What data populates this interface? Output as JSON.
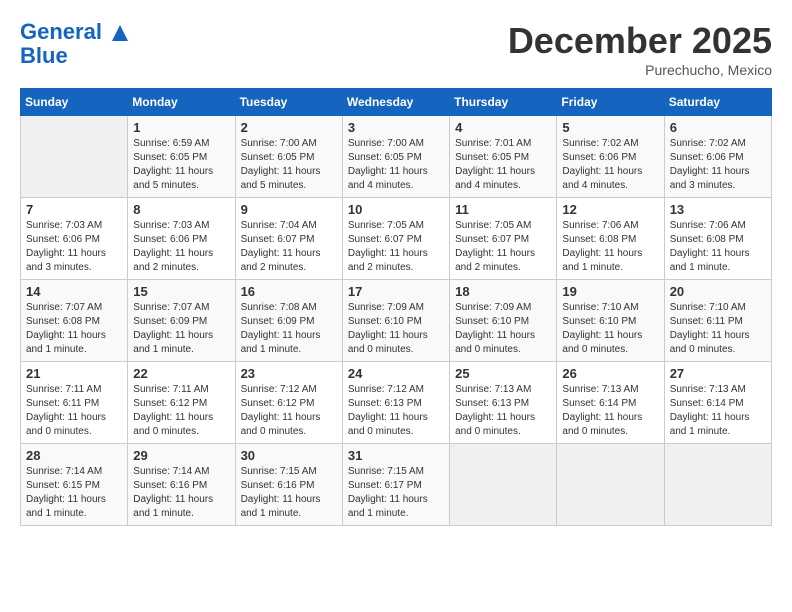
{
  "header": {
    "logo_line1": "General",
    "logo_line2": "Blue",
    "month": "December 2025",
    "location": "Purechucho, Mexico"
  },
  "days_of_week": [
    "Sunday",
    "Monday",
    "Tuesday",
    "Wednesday",
    "Thursday",
    "Friday",
    "Saturday"
  ],
  "weeks": [
    [
      {
        "num": "",
        "empty": true
      },
      {
        "num": "1",
        "sunrise": "6:59 AM",
        "sunset": "6:05 PM",
        "daylight": "11 hours and 5 minutes."
      },
      {
        "num": "2",
        "sunrise": "7:00 AM",
        "sunset": "6:05 PM",
        "daylight": "11 hours and 5 minutes."
      },
      {
        "num": "3",
        "sunrise": "7:00 AM",
        "sunset": "6:05 PM",
        "daylight": "11 hours and 4 minutes."
      },
      {
        "num": "4",
        "sunrise": "7:01 AM",
        "sunset": "6:05 PM",
        "daylight": "11 hours and 4 minutes."
      },
      {
        "num": "5",
        "sunrise": "7:02 AM",
        "sunset": "6:06 PM",
        "daylight": "11 hours and 4 minutes."
      },
      {
        "num": "6",
        "sunrise": "7:02 AM",
        "sunset": "6:06 PM",
        "daylight": "11 hours and 3 minutes."
      }
    ],
    [
      {
        "num": "7",
        "sunrise": "7:03 AM",
        "sunset": "6:06 PM",
        "daylight": "11 hours and 3 minutes."
      },
      {
        "num": "8",
        "sunrise": "7:03 AM",
        "sunset": "6:06 PM",
        "daylight": "11 hours and 2 minutes."
      },
      {
        "num": "9",
        "sunrise": "7:04 AM",
        "sunset": "6:07 PM",
        "daylight": "11 hours and 2 minutes."
      },
      {
        "num": "10",
        "sunrise": "7:05 AM",
        "sunset": "6:07 PM",
        "daylight": "11 hours and 2 minutes."
      },
      {
        "num": "11",
        "sunrise": "7:05 AM",
        "sunset": "6:07 PM",
        "daylight": "11 hours and 2 minutes."
      },
      {
        "num": "12",
        "sunrise": "7:06 AM",
        "sunset": "6:08 PM",
        "daylight": "11 hours and 1 minute."
      },
      {
        "num": "13",
        "sunrise": "7:06 AM",
        "sunset": "6:08 PM",
        "daylight": "11 hours and 1 minute."
      }
    ],
    [
      {
        "num": "14",
        "sunrise": "7:07 AM",
        "sunset": "6:08 PM",
        "daylight": "11 hours and 1 minute."
      },
      {
        "num": "15",
        "sunrise": "7:07 AM",
        "sunset": "6:09 PM",
        "daylight": "11 hours and 1 minute."
      },
      {
        "num": "16",
        "sunrise": "7:08 AM",
        "sunset": "6:09 PM",
        "daylight": "11 hours and 1 minute."
      },
      {
        "num": "17",
        "sunrise": "7:09 AM",
        "sunset": "6:10 PM",
        "daylight": "11 hours and 0 minutes."
      },
      {
        "num": "18",
        "sunrise": "7:09 AM",
        "sunset": "6:10 PM",
        "daylight": "11 hours and 0 minutes."
      },
      {
        "num": "19",
        "sunrise": "7:10 AM",
        "sunset": "6:10 PM",
        "daylight": "11 hours and 0 minutes."
      },
      {
        "num": "20",
        "sunrise": "7:10 AM",
        "sunset": "6:11 PM",
        "daylight": "11 hours and 0 minutes."
      }
    ],
    [
      {
        "num": "21",
        "sunrise": "7:11 AM",
        "sunset": "6:11 PM",
        "daylight": "11 hours and 0 minutes."
      },
      {
        "num": "22",
        "sunrise": "7:11 AM",
        "sunset": "6:12 PM",
        "daylight": "11 hours and 0 minutes."
      },
      {
        "num": "23",
        "sunrise": "7:12 AM",
        "sunset": "6:12 PM",
        "daylight": "11 hours and 0 minutes."
      },
      {
        "num": "24",
        "sunrise": "7:12 AM",
        "sunset": "6:13 PM",
        "daylight": "11 hours and 0 minutes."
      },
      {
        "num": "25",
        "sunrise": "7:13 AM",
        "sunset": "6:13 PM",
        "daylight": "11 hours and 0 minutes."
      },
      {
        "num": "26",
        "sunrise": "7:13 AM",
        "sunset": "6:14 PM",
        "daylight": "11 hours and 0 minutes."
      },
      {
        "num": "27",
        "sunrise": "7:13 AM",
        "sunset": "6:14 PM",
        "daylight": "11 hours and 1 minute."
      }
    ],
    [
      {
        "num": "28",
        "sunrise": "7:14 AM",
        "sunset": "6:15 PM",
        "daylight": "11 hours and 1 minute."
      },
      {
        "num": "29",
        "sunrise": "7:14 AM",
        "sunset": "6:16 PM",
        "daylight": "11 hours and 1 minute."
      },
      {
        "num": "30",
        "sunrise": "7:15 AM",
        "sunset": "6:16 PM",
        "daylight": "11 hours and 1 minute."
      },
      {
        "num": "31",
        "sunrise": "7:15 AM",
        "sunset": "6:17 PM",
        "daylight": "11 hours and 1 minute."
      },
      {
        "num": "",
        "empty": true
      },
      {
        "num": "",
        "empty": true
      },
      {
        "num": "",
        "empty": true
      }
    ]
  ]
}
